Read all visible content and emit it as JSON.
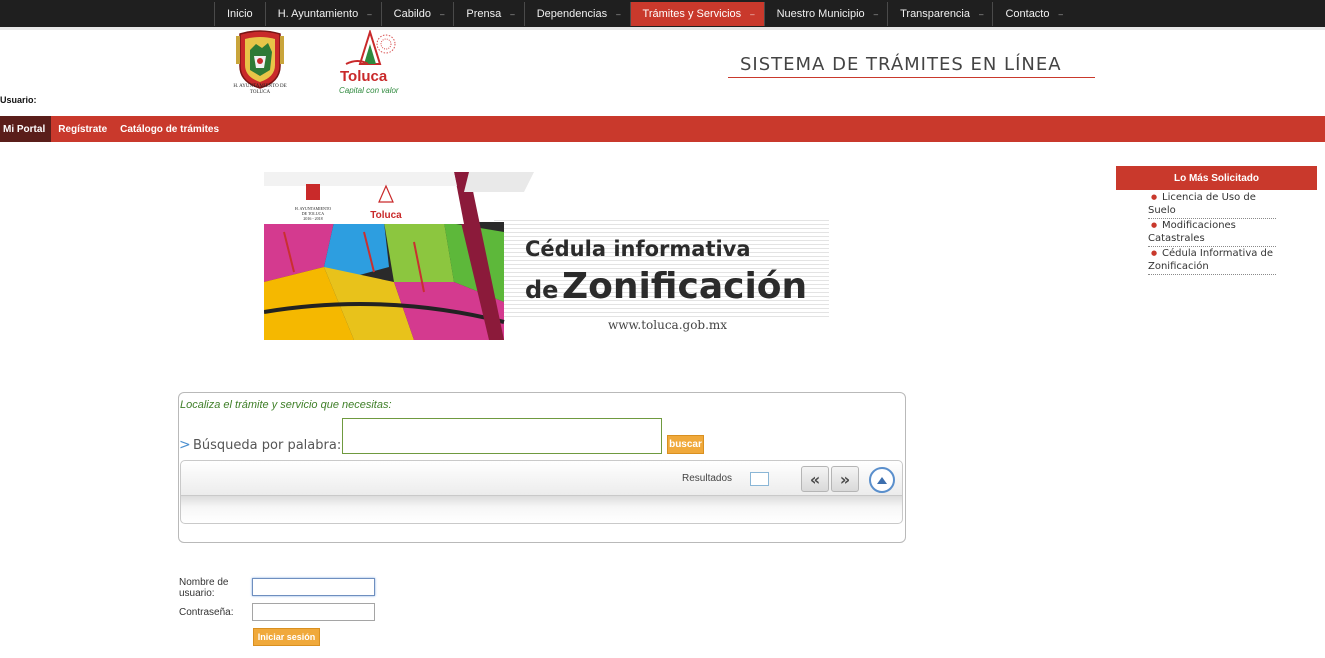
{
  "topnav": {
    "items": [
      {
        "label": "Inicio",
        "dropdown": false
      },
      {
        "label": "H. Ayuntamiento",
        "dropdown": true
      },
      {
        "label": "Cabildo",
        "dropdown": true
      },
      {
        "label": "Prensa",
        "dropdown": true
      },
      {
        "label": "Dependencias",
        "dropdown": true
      },
      {
        "label": "Trámites y Servicios",
        "dropdown": true,
        "active": true
      },
      {
        "label": "Nuestro Municipio",
        "dropdown": true
      },
      {
        "label": "Transparencia",
        "dropdown": true
      },
      {
        "label": "Contacto",
        "dropdown": true
      }
    ],
    "caret": "–"
  },
  "header": {
    "crest_caption": "H. AYUNTAMIENTO DE TOLUCA",
    "logo_word": "Toluca",
    "logo_slogan": "Capital con valor",
    "system_title": "SISTEMA DE TRÁMITES EN LÍNEA",
    "user_label": "Usuario:"
  },
  "menu": {
    "items": [
      "Mi Portal",
      "Regístrate",
      "Catálogo de trámites"
    ]
  },
  "banner": {
    "line1": "Cédula informativa",
    "line2_prefix": "de",
    "line2_main": "Zonificación",
    "url": "www.toluca.gob.mx",
    "mini_caption": "H. AYUNTAMIENTO DE TOLUCA 2016 - 2018",
    "mini_logo": "Toluca"
  },
  "sidebar": {
    "title": "Lo Más Solicitado",
    "items": [
      "Licencia de Uso de Suelo",
      "Modificaciones Catastrales",
      "Cédula Informativa de Zonificación"
    ]
  },
  "search": {
    "hint": "Localiza el trámite y servicio que necesitas:",
    "arrow": ">",
    "label": "Búsqueda por palabra:",
    "value": "",
    "button": "buscar",
    "results_label": "Resultados",
    "prev": "«",
    "next": "»"
  },
  "login": {
    "user_label": "Nombre de usuario:",
    "pass_label": "Contraseña:",
    "submit": "Iniciar sesión"
  },
  "colors": {
    "accent_red": "#c9392c",
    "dark_nav": "#1f1f1f",
    "button_orange": "#f0a93b",
    "hint_green": "#3f7f28"
  }
}
